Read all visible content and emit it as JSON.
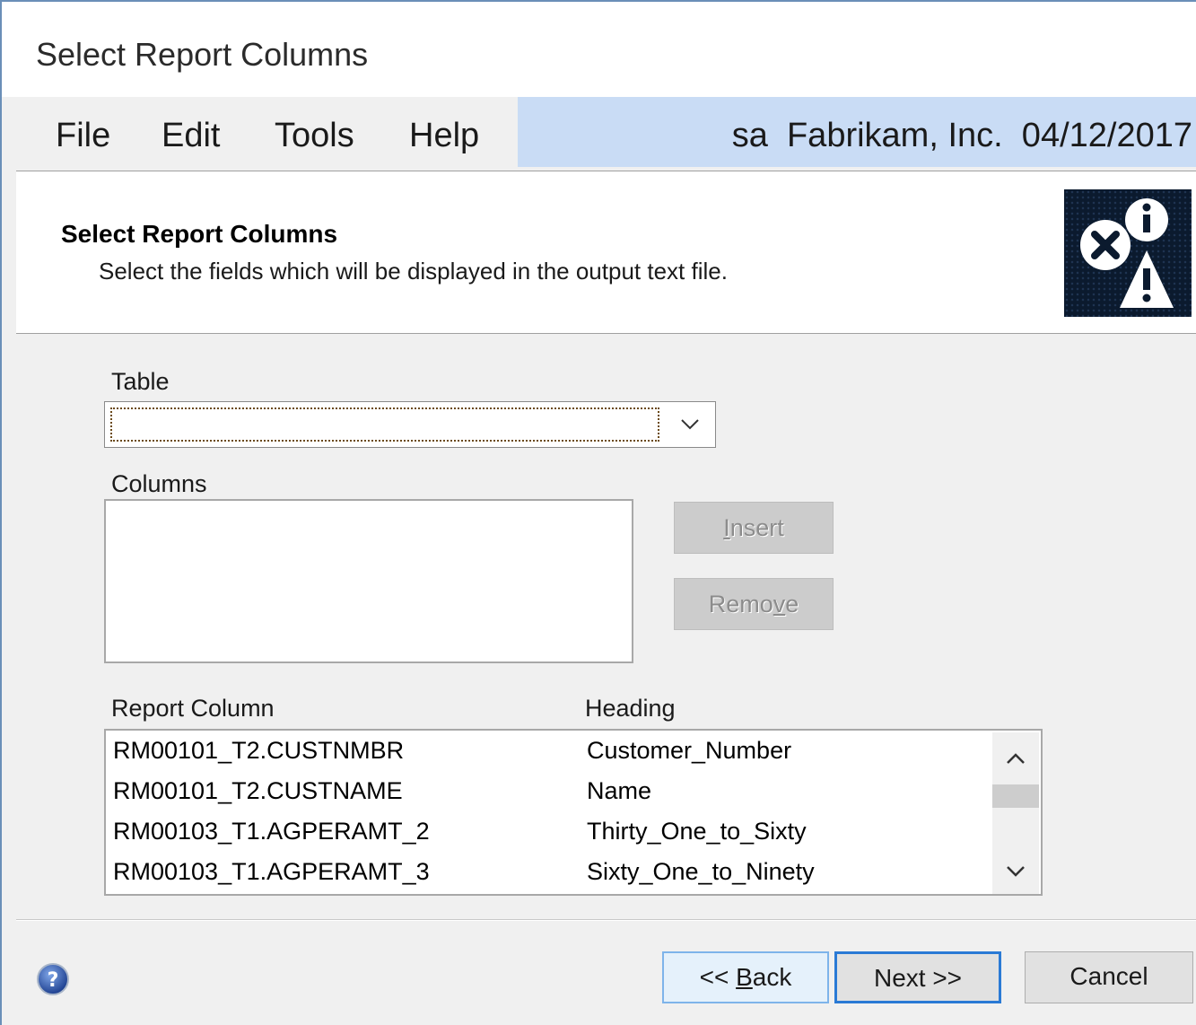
{
  "window": {
    "title": "Select Report Columns"
  },
  "menu": {
    "items": [
      "File",
      "Edit",
      "Tools",
      "Help"
    ],
    "info": "sa  Fabrikam, Inc.  04/12/2017"
  },
  "header": {
    "title": "Select Report Columns",
    "subtitle": "Select the fields which will be displayed in the output text file."
  },
  "table": {
    "label": "Table",
    "value": ""
  },
  "columns": {
    "label": "Columns",
    "items": []
  },
  "buttons": {
    "insert": {
      "pre": "",
      "accel": "I",
      "post": "nsert"
    },
    "remove": {
      "pre": "Remo",
      "accel": "v",
      "post": "e"
    },
    "back": {
      "pre": "<< ",
      "accel": "B",
      "post": "ack"
    },
    "next": "Next >>",
    "cancel": "Cancel"
  },
  "report_grid": {
    "headers": [
      "Report Column",
      "Heading"
    ],
    "rows": [
      [
        "RM00101_T2.CUSTNMBR",
        "Customer_Number"
      ],
      [
        "RM00101_T2.CUSTNAME",
        "Name"
      ],
      [
        "RM00103_T1.AGPERAMT_2",
        "Thirty_One_to_Sixty"
      ],
      [
        "RM00103_T1.AGPERAMT_3",
        "Sixty_One_to_Ninety"
      ]
    ]
  },
  "icons": {
    "header_logo": "error-info-warning-icon",
    "help": "help-icon",
    "combo_arrow": "chevron-down-icon",
    "scroll_up": "chevron-up-icon",
    "scroll_down": "chevron-down-icon"
  }
}
